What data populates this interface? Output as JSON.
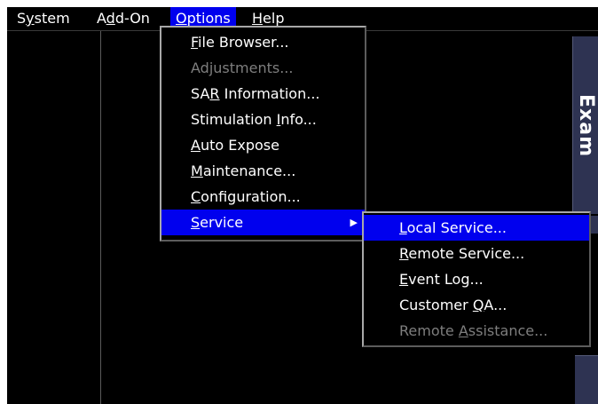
{
  "menubar": {
    "items": [
      {
        "pre": "S",
        "ul": "y",
        "post": "stem"
      },
      {
        "pre": "A",
        "ul": "d",
        "post": "d-On"
      },
      {
        "pre": "",
        "ul": "O",
        "post": "ptions"
      },
      {
        "pre": "",
        "ul": "H",
        "post": "elp"
      }
    ]
  },
  "side_panel": {
    "label": "Exam"
  },
  "options_menu": {
    "items": [
      {
        "pre": "",
        "ul": "F",
        "post": "ile Browser..."
      },
      {
        "pre": "",
        "ul": "",
        "post": "Adjustments..."
      },
      {
        "pre": "SA",
        "ul": "R",
        "post": " Information..."
      },
      {
        "pre": "Stimulation ",
        "ul": "I",
        "post": "nfo..."
      },
      {
        "pre": "",
        "ul": "A",
        "post": "uto Expose"
      },
      {
        "pre": "",
        "ul": "M",
        "post": "aintenance..."
      },
      {
        "pre": "",
        "ul": "C",
        "post": "onfiguration..."
      },
      {
        "pre": "",
        "ul": "S",
        "post": "ervice"
      }
    ],
    "submenu_arrow": "▶"
  },
  "service_menu": {
    "items": [
      {
        "pre": "",
        "ul": "L",
        "post": "ocal Service..."
      },
      {
        "pre": "",
        "ul": "R",
        "post": "emote Service..."
      },
      {
        "pre": "",
        "ul": "E",
        "post": "vent Log..."
      },
      {
        "pre": "Customer ",
        "ul": "Q",
        "post": "A..."
      },
      {
        "pre": "Remote ",
        "ul": "A",
        "post": "ssistance..."
      }
    ]
  },
  "colors": {
    "highlight": "#0000ee",
    "background": "#000000",
    "disabled_text": "#7e7e7e",
    "panel": "#2e3352"
  }
}
